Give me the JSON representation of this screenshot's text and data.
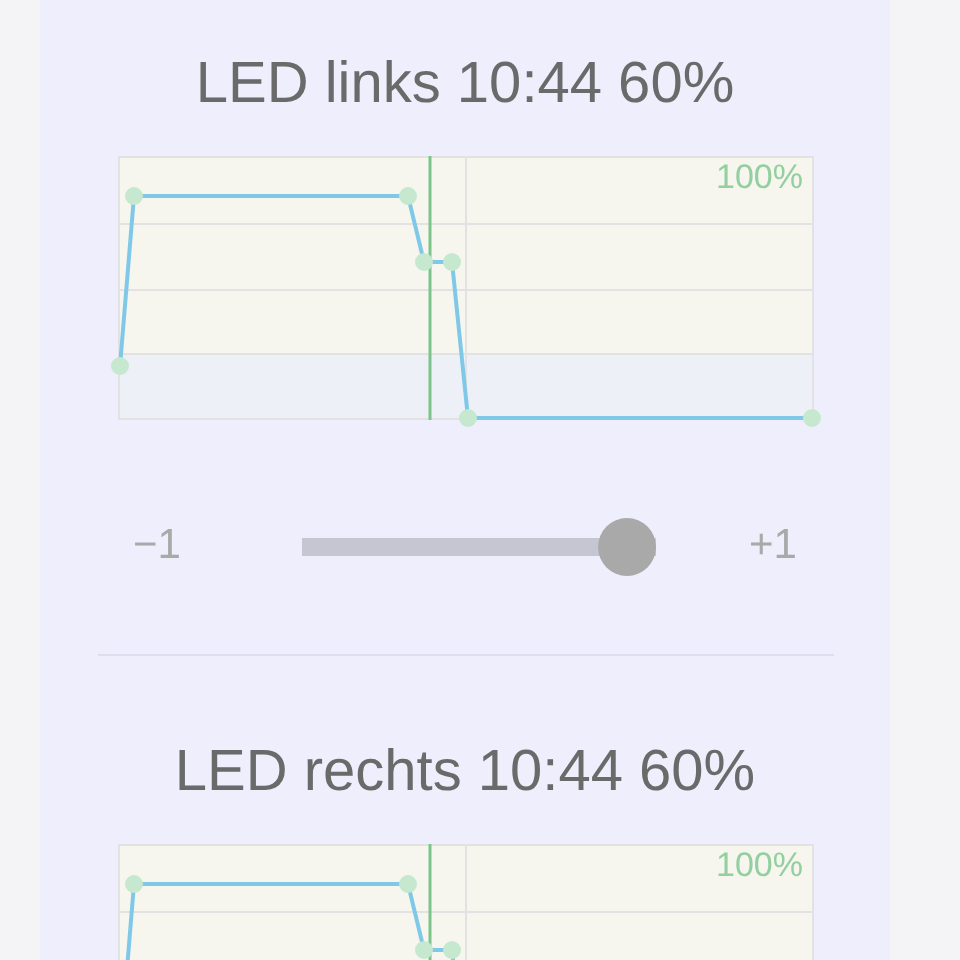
{
  "sections": [
    {
      "title": "LED links 10:44 60%",
      "chart": {
        "max_label": "100%"
      },
      "slider": {
        "min_label": "−1",
        "max_label": "+1",
        "level": 1
      }
    },
    {
      "title": "LED rechts 10:44 60%",
      "chart": {
        "max_label": "100%"
      }
    }
  ]
}
